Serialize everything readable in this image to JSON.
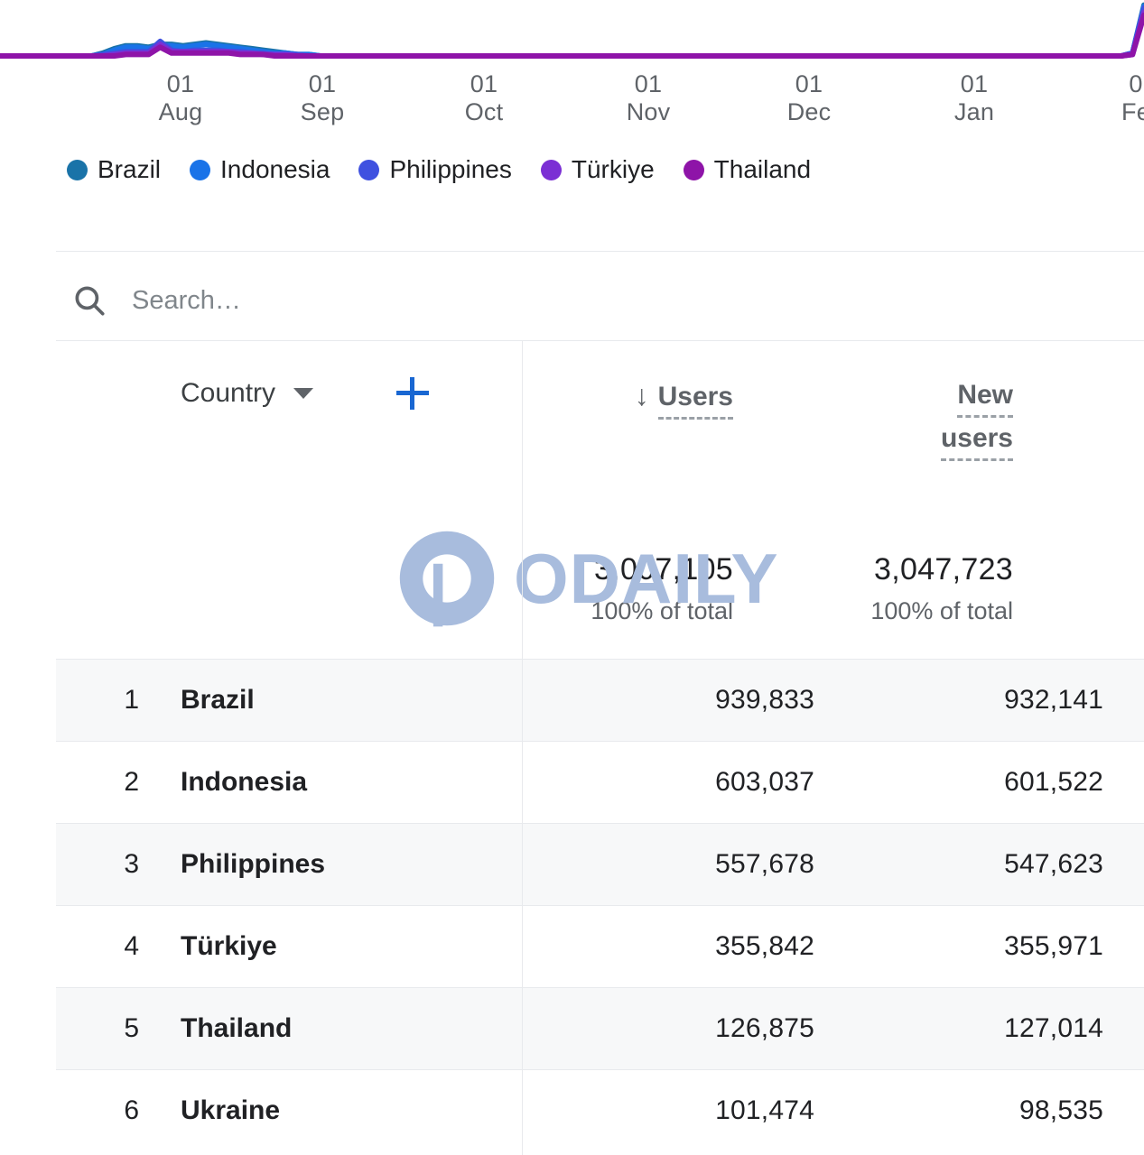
{
  "chart_data": {
    "type": "line",
    "title": "",
    "xlabel": "",
    "ylabel": "",
    "grid": false,
    "legend_position": "bottom",
    "x_ticks": [
      {
        "day": "01",
        "month": "Aug"
      },
      {
        "day": "01",
        "month": "Sep"
      },
      {
        "day": "01",
        "month": "Oct"
      },
      {
        "day": "01",
        "month": "Nov"
      },
      {
        "day": "01",
        "month": "Dec"
      },
      {
        "day": "01",
        "month": "Jan"
      },
      {
        "day": "0",
        "month": "Fe"
      }
    ],
    "series": [
      {
        "name": "Brazil",
        "color": "#1a73a8",
        "values": [
          0,
          0,
          0,
          0,
          0,
          0,
          0,
          0,
          0,
          2,
          5,
          7,
          7,
          6,
          8,
          8,
          7,
          8,
          9,
          8,
          7,
          6,
          5,
          4,
          3,
          2,
          1,
          1,
          0,
          0,
          0,
          0,
          0,
          0,
          0,
          0,
          0,
          0,
          0,
          0,
          0,
          0,
          0,
          0,
          0,
          0,
          0,
          0,
          0,
          0,
          0,
          0,
          0,
          0,
          0,
          0,
          0,
          0,
          0,
          0,
          0,
          0,
          0,
          0,
          0,
          0,
          0,
          0,
          0,
          0,
          0,
          0,
          0,
          0,
          0,
          0,
          0,
          0,
          0,
          0,
          0,
          0,
          0,
          0,
          0,
          0,
          0,
          0,
          0,
          0,
          0,
          0,
          0,
          0,
          0,
          0,
          0,
          0,
          0,
          2,
          35
        ]
      },
      {
        "name": "Indonesia",
        "color": "#1a73e8",
        "values": [
          0,
          0,
          0,
          0,
          0,
          0,
          0,
          0,
          0,
          1,
          4,
          6,
          6,
          5,
          7,
          7,
          6,
          7,
          8,
          7,
          6,
          5,
          4,
          3,
          2,
          2,
          1,
          1,
          0,
          0,
          0,
          0,
          0,
          0,
          0,
          0,
          0,
          0,
          0,
          0,
          0,
          0,
          0,
          0,
          0,
          0,
          0,
          0,
          0,
          0,
          0,
          0,
          0,
          0,
          0,
          0,
          0,
          0,
          0,
          0,
          0,
          0,
          0,
          0,
          0,
          0,
          0,
          0,
          0,
          0,
          0,
          0,
          0,
          0,
          0,
          0,
          0,
          0,
          0,
          0,
          0,
          0,
          0,
          0,
          0,
          0,
          0,
          0,
          0,
          0,
          0,
          0,
          0,
          0,
          0,
          0,
          0,
          0,
          0,
          2,
          34
        ]
      },
      {
        "name": "Philippines",
        "color": "#3f51e0",
        "values": [
          0,
          0,
          0,
          0,
          0,
          0,
          0,
          0,
          0,
          1,
          2,
          3,
          3,
          3,
          10,
          4,
          3,
          4,
          4,
          4,
          3,
          3,
          2,
          2,
          1,
          1,
          1,
          0,
          0,
          0,
          0,
          0,
          0,
          0,
          0,
          0,
          0,
          0,
          0,
          0,
          0,
          0,
          0,
          0,
          0,
          0,
          0,
          0,
          0,
          0,
          0,
          0,
          0,
          0,
          0,
          0,
          0,
          0,
          0,
          0,
          0,
          0,
          0,
          0,
          0,
          0,
          0,
          0,
          0,
          0,
          0,
          0,
          0,
          0,
          0,
          0,
          0,
          0,
          0,
          0,
          0,
          0,
          0,
          0,
          0,
          0,
          0,
          0,
          0,
          0,
          0,
          0,
          0,
          0,
          0,
          0,
          0,
          0,
          0,
          2,
          33
        ]
      },
      {
        "name": "Türkiye",
        "color": "#7b2fd4",
        "values": [
          0,
          0,
          0,
          0,
          0,
          0,
          0,
          0,
          0,
          0,
          1,
          2,
          2,
          2,
          8,
          3,
          3,
          3,
          3,
          3,
          3,
          2,
          2,
          1,
          1,
          1,
          0,
          0,
          0,
          0,
          0,
          0,
          0,
          0,
          0,
          0,
          0,
          0,
          0,
          0,
          0,
          0,
          0,
          0,
          0,
          0,
          0,
          0,
          0,
          0,
          0,
          0,
          0,
          0,
          0,
          0,
          0,
          0,
          0,
          0,
          0,
          0,
          0,
          0,
          0,
          0,
          0,
          0,
          0,
          0,
          0,
          0,
          0,
          0,
          0,
          0,
          0,
          0,
          0,
          0,
          0,
          0,
          0,
          0,
          0,
          0,
          0,
          0,
          0,
          0,
          0,
          0,
          0,
          0,
          0,
          0,
          0,
          0,
          0,
          1,
          30
        ]
      },
      {
        "name": "Thailand",
        "color": "#8e14a8",
        "values": [
          0,
          0,
          0,
          0,
          0,
          0,
          0,
          0,
          0,
          0,
          0,
          1,
          1,
          1,
          6,
          2,
          2,
          2,
          2,
          2,
          2,
          1,
          1,
          1,
          0,
          0,
          0,
          0,
          0,
          0,
          0,
          0,
          0,
          0,
          0,
          0,
          0,
          0,
          0,
          0,
          0,
          0,
          0,
          0,
          0,
          0,
          0,
          0,
          0,
          0,
          0,
          0,
          0,
          0,
          0,
          0,
          0,
          0,
          0,
          0,
          0,
          0,
          0,
          0,
          0,
          0,
          0,
          0,
          0,
          0,
          0,
          0,
          0,
          0,
          0,
          0,
          0,
          0,
          0,
          0,
          0,
          0,
          0,
          0,
          0,
          0,
          0,
          0,
          0,
          0,
          0,
          0,
          0,
          0,
          0,
          0,
          0,
          0,
          0,
          1,
          28
        ]
      }
    ]
  },
  "legend": {
    "items": [
      {
        "label": "Brazil",
        "color": "#1a73a8"
      },
      {
        "label": "Indonesia",
        "color": "#1a73e8"
      },
      {
        "label": "Philippines",
        "color": "#3f51e0"
      },
      {
        "label": "Türkiye",
        "color": "#7b2fd4"
      },
      {
        "label": "Thailand",
        "color": "#8e14a8"
      }
    ]
  },
  "search": {
    "placeholder": "Search…",
    "value": "",
    "icon": "search-icon"
  },
  "watermark": {
    "text": "ODAILY",
    "color": "#a8bcdd"
  },
  "table": {
    "dimension": {
      "label": "Country",
      "caret_icon": "chevron-down-icon",
      "add_icon": "plus-icon"
    },
    "metrics": [
      {
        "key": "users",
        "line1": "Users",
        "line2": "",
        "sorted": true,
        "sort_icon": "arrow-down-icon"
      },
      {
        "key": "new_users",
        "line1": "New",
        "line2": "users",
        "sorted": false,
        "sort_icon": ""
      }
    ],
    "totals": [
      {
        "value": "3,007,105",
        "sub": "100% of total"
      },
      {
        "value": "3,047,723",
        "sub": "100% of total"
      }
    ],
    "rows": [
      {
        "rank": "1",
        "name": "Brazil",
        "users": "939,833",
        "new_users": "932,141"
      },
      {
        "rank": "2",
        "name": "Indonesia",
        "users": "603,037",
        "new_users": "601,522"
      },
      {
        "rank": "3",
        "name": "Philippines",
        "users": "557,678",
        "new_users": "547,623"
      },
      {
        "rank": "4",
        "name": "Türkiye",
        "users": "355,842",
        "new_users": "355,971"
      },
      {
        "rank": "5",
        "name": "Thailand",
        "users": "126,875",
        "new_users": "127,014"
      },
      {
        "rank": "6",
        "name": "Ukraine",
        "users": "101,474",
        "new_users": "98,535"
      }
    ]
  },
  "colors": {
    "accent_blue": "#1967d2",
    "text_primary": "#202124",
    "text_secondary": "#5f6368",
    "divider": "#e8eaed",
    "row_alt": "#f7f8f9"
  }
}
